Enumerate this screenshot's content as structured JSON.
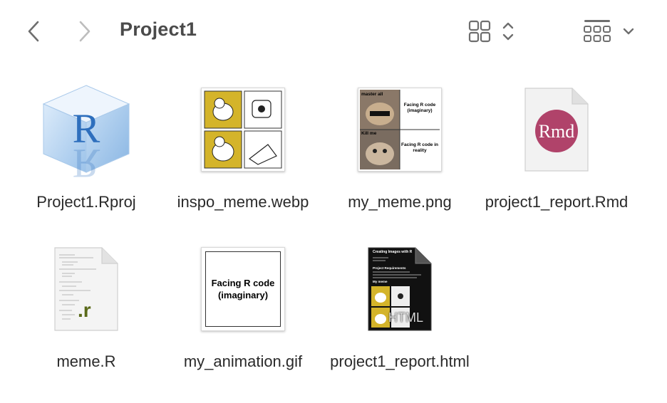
{
  "window": {
    "title": "Project1"
  },
  "toolbar": {
    "back_icon": "chevron-left-icon",
    "forward_icon": "chevron-right-icon",
    "view_icon": "grid-view-icon",
    "group_icon": "group-by-icon"
  },
  "files": [
    {
      "name": "Project1.Rproj",
      "icon": "rproj-icon"
    },
    {
      "name": "inspo_meme.webp",
      "icon": "image-thumbnail"
    },
    {
      "name": "my_meme.png",
      "icon": "image-thumbnail"
    },
    {
      "name": "project1_report.Rmd",
      "icon": "rmd-document-icon",
      "badge": "Rmd"
    },
    {
      "name": "meme.R",
      "icon": "r-script-icon",
      "badge": ".r"
    },
    {
      "name": "my_animation.gif",
      "icon": "gif-thumbnail",
      "preview_text": "Facing R code (imaginary)"
    },
    {
      "name": "project1_report.html",
      "icon": "html-document-icon",
      "badge": "HTML"
    }
  ],
  "thumbnails": {
    "my_meme": {
      "top_caption": "master all",
      "right_top": "Facing R code (imaginary)",
      "mid_caption": "Kill me",
      "right_bottom": "Facing R code in reality"
    },
    "html_report": {
      "heading": "Creating Images with R",
      "section": "Project Requirements",
      "sub": "My meme"
    }
  },
  "colors": {
    "title": "#4a4a4a",
    "rmd_badge": "#b0436a",
    "r_badge": "#5a6a1a",
    "meme_yellow": "#d4b42a",
    "rproj_blue": "#5b9ad5"
  }
}
